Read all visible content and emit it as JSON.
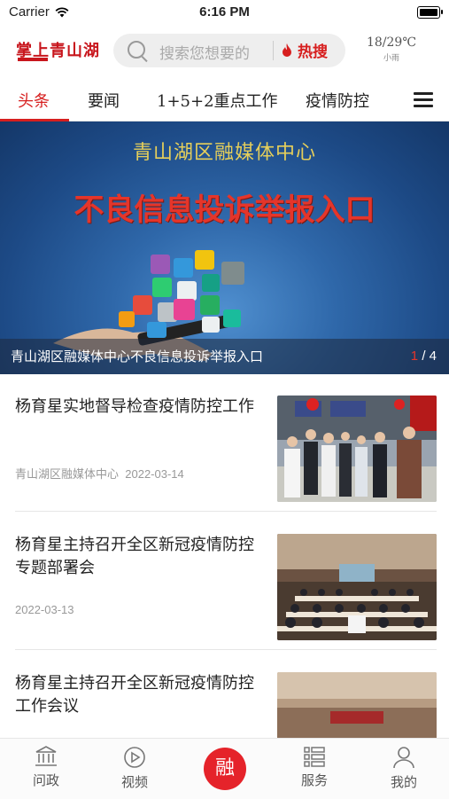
{
  "status": {
    "carrier": "Carrier",
    "time": "6:16 PM"
  },
  "header": {
    "logo": "掌上青山湖",
    "search_placeholder": "搜索您想要的",
    "hot_label": "热搜",
    "weather_temp": "18/29℃",
    "weather_cond": "小雨"
  },
  "tabs": [
    "头条",
    "要闻",
    "1+5+2重点工作",
    "疫情防控"
  ],
  "banner": {
    "heading": "青山湖区融媒体中心",
    "headline": "不良信息投诉举报入口",
    "caption": "青山湖区融媒体中心不良信息投诉举报入口",
    "page_current": "1",
    "page_total": "/ 4"
  },
  "news": [
    {
      "title": "杨育星实地督导检查疫情防控工作",
      "source": "青山湖区融媒体中心",
      "date": "2022-03-14"
    },
    {
      "title": "杨育星主持召开全区新冠疫情防控专题部署会",
      "source": "",
      "date": "2022-03-13"
    },
    {
      "title": "杨育星主持召开全区新冠疫情防控工作会议",
      "source": "",
      "date": ""
    }
  ],
  "bottom_nav": [
    {
      "label": "问政",
      "icon": "building-icon"
    },
    {
      "label": "视频",
      "icon": "play-icon"
    },
    {
      "label": "融",
      "icon": "center-button"
    },
    {
      "label": "服务",
      "icon": "list-icon"
    },
    {
      "label": "我的",
      "icon": "user-icon"
    }
  ],
  "colors": {
    "brand_red": "#d71f1f",
    "banner_blue": "#2f68aa"
  }
}
